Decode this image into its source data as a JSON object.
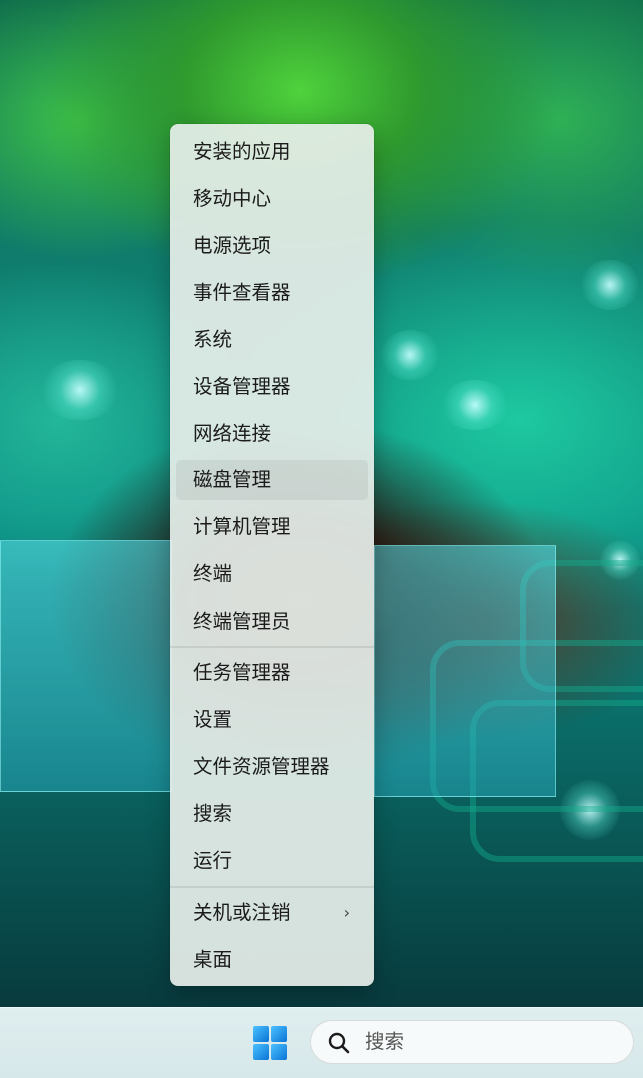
{
  "context_menu": {
    "items": [
      {
        "label": "安装的应用"
      },
      {
        "label": "移动中心"
      },
      {
        "label": "电源选项"
      },
      {
        "label": "事件查看器"
      },
      {
        "label": "系统"
      },
      {
        "label": "设备管理器"
      },
      {
        "label": "网络连接"
      },
      {
        "label": "磁盘管理"
      },
      {
        "label": "计算机管理"
      },
      {
        "label": "终端"
      },
      {
        "label": "终端管理员"
      },
      {
        "label": "任务管理器"
      },
      {
        "label": "设置"
      },
      {
        "label": "文件资源管理器"
      },
      {
        "label": "搜索"
      },
      {
        "label": "运行"
      },
      {
        "label": "关机或注销",
        "submenu_indicator": "›"
      },
      {
        "label": "桌面"
      }
    ],
    "highlighted_item": "磁盘管理"
  },
  "taskbar": {
    "start_icon": "windows-logo-icon",
    "search": {
      "icon": "search-icon",
      "placeholder": "搜索"
    }
  },
  "colors": {
    "menu_background": "#e6eeea",
    "taskbar_background": "#dfeeef",
    "windows_blue": "#0a74d6"
  }
}
